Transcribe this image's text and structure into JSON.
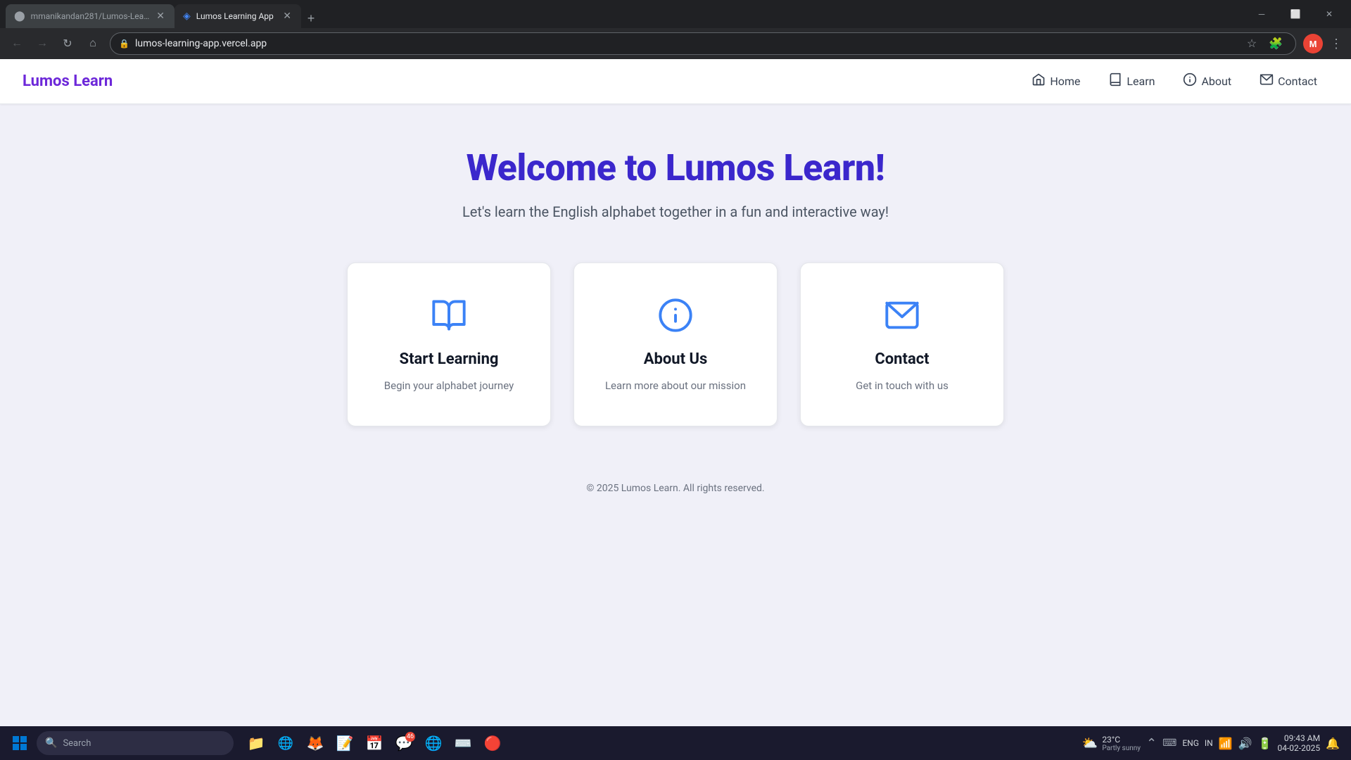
{
  "browser": {
    "tabs": [
      {
        "id": "tab1",
        "title": "mmanikandan281/Lumos-Learn",
        "favicon": "gh",
        "active": false
      },
      {
        "id": "tab2",
        "title": "Lumos Learning App",
        "favicon": "lumos",
        "active": true
      }
    ],
    "address": "lumos-learning-app.vercel.app",
    "back_disabled": false,
    "forward_disabled": true
  },
  "navbar": {
    "logo": "Lumos Learn",
    "links": [
      {
        "id": "home",
        "label": "Home",
        "icon": "home-icon"
      },
      {
        "id": "learn",
        "label": "Learn",
        "icon": "book-icon"
      },
      {
        "id": "about",
        "label": "About",
        "icon": "info-icon"
      },
      {
        "id": "contact",
        "label": "Contact",
        "icon": "mail-icon"
      }
    ]
  },
  "hero": {
    "title": "Welcome to Lumos Learn!",
    "subtitle": "Let's learn the English alphabet together in a fun and interactive way!"
  },
  "cards": [
    {
      "id": "start-learning",
      "icon": "book-open-icon",
      "title": "Start Learning",
      "description": "Begin your alphabet journey"
    },
    {
      "id": "about-us",
      "icon": "info-circle-icon",
      "title": "About Us",
      "description": "Learn more about our mission"
    },
    {
      "id": "contact",
      "icon": "mail-icon",
      "title": "Contact",
      "description": "Get in touch with us"
    }
  ],
  "footer": {
    "text": "© 2025 Lumos Learn. All rights reserved."
  },
  "taskbar": {
    "search_placeholder": "Search",
    "weather": "23°C",
    "weather_desc": "Partly sunny",
    "language": "ENG",
    "region": "IN",
    "time": "09:43 AM",
    "date": "04-02-2025"
  }
}
